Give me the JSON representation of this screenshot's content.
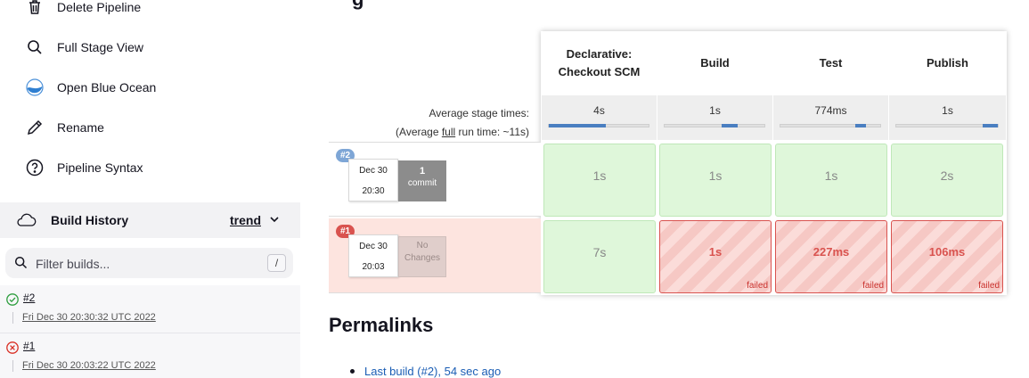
{
  "sidebar": {
    "tasks": [
      {
        "label": "Delete Pipeline",
        "icon": "trash-icon"
      },
      {
        "label": "Full Stage View",
        "icon": "search-icon"
      },
      {
        "label": "Open Blue Ocean",
        "icon": "blue-ocean-icon"
      },
      {
        "label": "Rename",
        "icon": "pencil-icon"
      },
      {
        "label": "Pipeline Syntax",
        "icon": "question-icon"
      }
    ],
    "build_history": {
      "title": "Build History",
      "trend": "trend",
      "filter_placeholder": "Filter builds...",
      "shortcut": "/",
      "builds": [
        {
          "number": "#2",
          "status": "success",
          "timestamp": "Fri Dec 30 20:30:32 UTC 2022"
        },
        {
          "number": "#1",
          "status": "failure",
          "timestamp": "Fri Dec 30 20:03:22 UTC 2022"
        }
      ]
    }
  },
  "stage_view": {
    "stages": [
      "Declarative: Checkout SCM",
      "Build",
      "Test",
      "Publish"
    ],
    "avg_label_line1": "Average stage times:",
    "avg_label_prefix": "(Average ",
    "avg_label_link": "full",
    "avg_label_suffix": " run time: ~11s)",
    "averages": [
      {
        "time": "4s",
        "fill_start": 0.0,
        "fill_fraction": 0.57
      },
      {
        "time": "1s",
        "fill_start": 0.57,
        "fill_fraction": 0.16
      },
      {
        "time": "774ms",
        "fill_start": 0.75,
        "fill_fraction": 0.11
      },
      {
        "time": "1s",
        "fill_start": 0.85,
        "fill_fraction": 0.15
      }
    ],
    "runs": [
      {
        "badge": "#2",
        "date": "Dec 30",
        "time": "20:30",
        "changes_count": "1",
        "changes_label": "commit",
        "status": "success",
        "stage_times": [
          "1s",
          "1s",
          "1s",
          "2s"
        ],
        "stage_status": [
          "pass",
          "pass",
          "pass",
          "pass"
        ]
      },
      {
        "badge": "#1",
        "date": "Dec 30",
        "time": "20:03",
        "changes_label": "No Changes",
        "status": "failure",
        "stage_times": [
          "7s",
          "1s",
          "227ms",
          "106ms"
        ],
        "stage_status": [
          "pass",
          "fail",
          "fail",
          "fail"
        ],
        "failed_label": "failed"
      }
    ]
  },
  "permalinks": {
    "title": "Permalinks",
    "items": [
      "Last build (#2), 54 sec ago"
    ]
  },
  "colors": {
    "success_badge": "#7ea6d6",
    "failure_badge": "#d9534f",
    "pass_cell": "#dff7da",
    "fail_cell": "#fbdcd9",
    "link": "#1a5db4"
  }
}
